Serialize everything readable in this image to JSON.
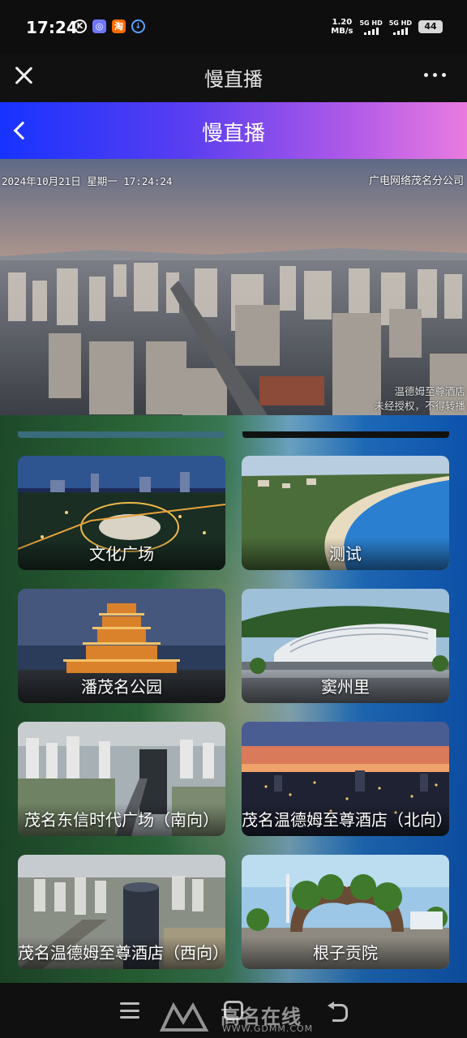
{
  "status_bar": {
    "time": "17:24",
    "icons": [
      "k-icon",
      "app-blue-icon",
      "taobao-icon",
      "download-icon"
    ],
    "speed_value": "1.20",
    "speed_unit": "MB/s",
    "sim1": "5G HD",
    "sim2": "5G HD",
    "battery": "44"
  },
  "app_bar": {
    "title": "慢直播"
  },
  "header": {
    "title": "慢直播",
    "gradient_colors": [
      "#1733ff",
      "#e97be0"
    ]
  },
  "live_video": {
    "datetime": "2024年10月21日  星期一  17:24:24",
    "organization": "广电网络茂名分公司",
    "watermark_line1": "温德姆至尊酒店",
    "watermark_line2": "未经授权，不得转播"
  },
  "cameras": [
    {
      "label": "文化广场"
    },
    {
      "label": "测试"
    },
    {
      "label": "潘茂名公园"
    },
    {
      "label": "窦州里"
    },
    {
      "label": "茂名东信时代广场（南向）"
    },
    {
      "label": "茂名温德姆至尊酒店（北向）"
    },
    {
      "label": "茂名温德姆至尊酒店（西向）"
    },
    {
      "label": "根子贡院"
    }
  ],
  "watermark": {
    "text": "高名在线",
    "url": "WWW.GDMM.COM"
  }
}
